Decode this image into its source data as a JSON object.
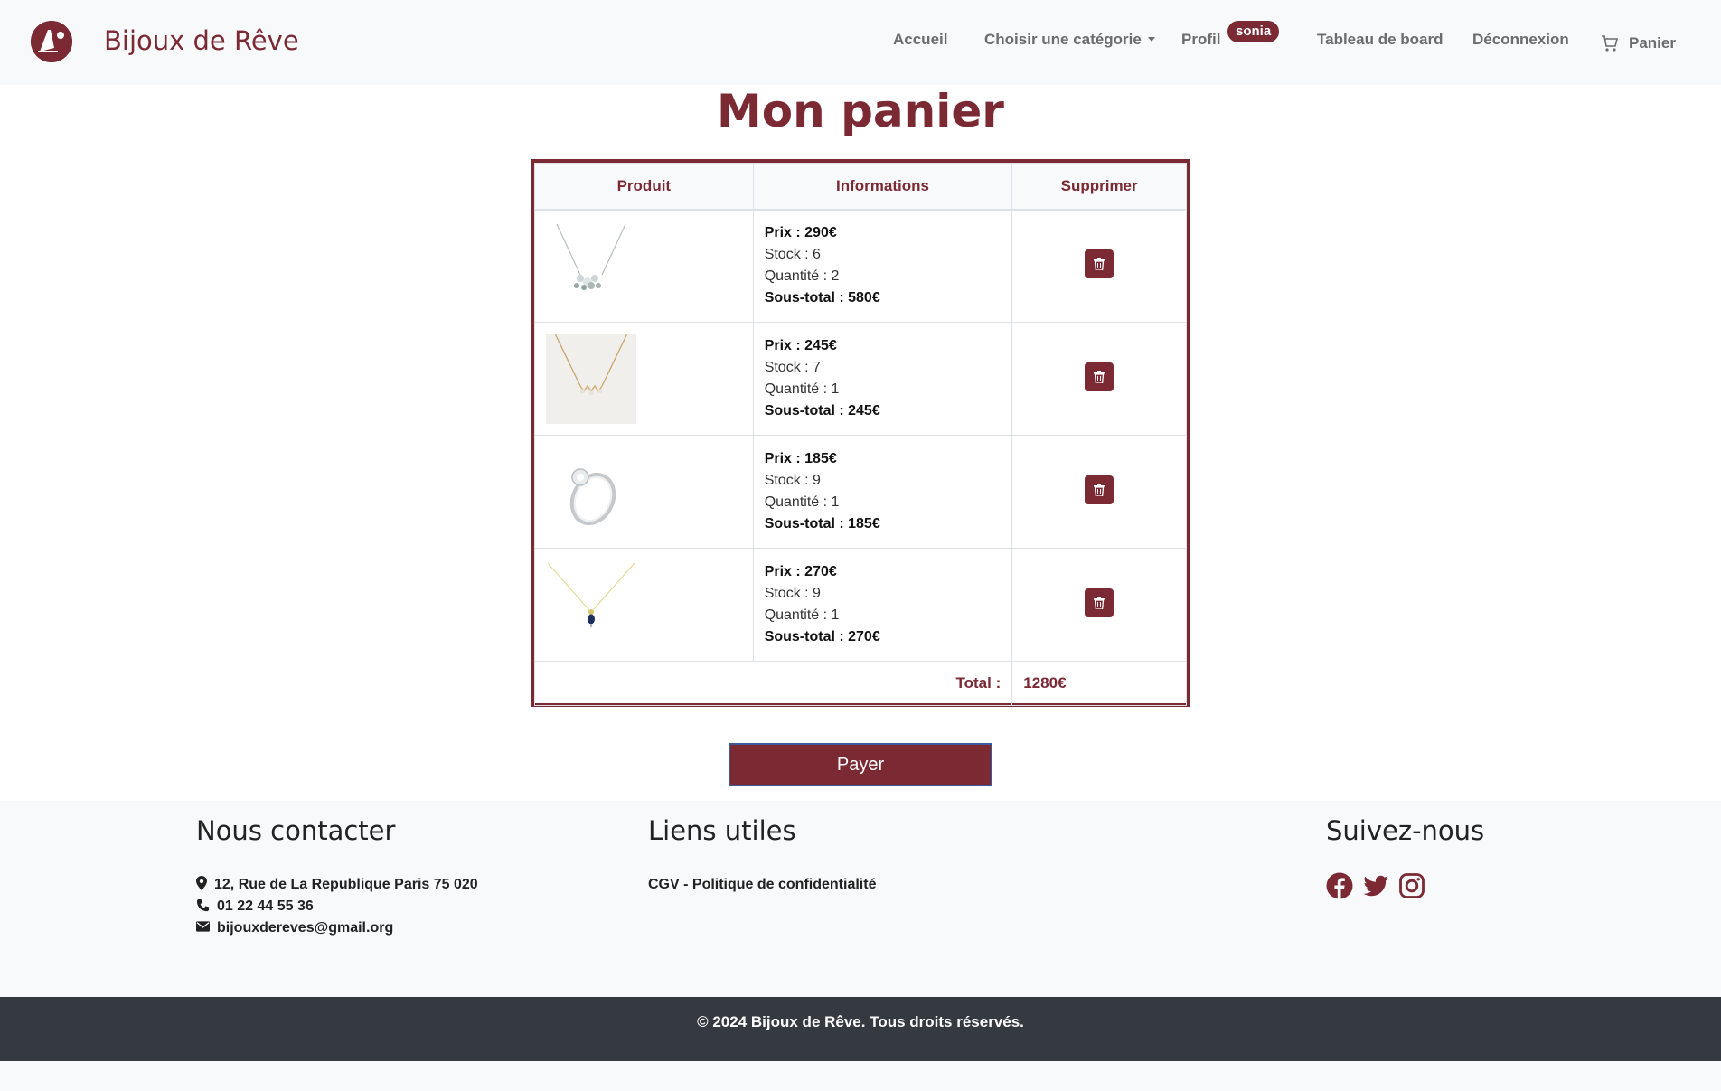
{
  "brand": {
    "name": "Bijoux de Rêve",
    "logo": "brand-logo"
  },
  "nav": {
    "home": "Accueil",
    "category": "Choisir une catégorie",
    "profile": "Profil",
    "user_badge": "sonia",
    "dashboard": "Tableau de board",
    "logout": "Déconnexion",
    "cart": "Panier"
  },
  "page": {
    "title": "Mon panier"
  },
  "table": {
    "headers": {
      "product": "Produit",
      "info": "Informations",
      "delete": "Supprimer"
    },
    "items": [
      {
        "image": "silver-necklace-icon",
        "price": "Prix : 290€",
        "stock": "Stock : 6",
        "quantity": "Quantité : 2",
        "subtotal": "Sous-total : 580€"
      },
      {
        "image": "gold-necklace-icon",
        "price": "Prix : 245€",
        "stock": "Stock : 7",
        "quantity": "Quantité : 1",
        "subtotal": "Sous-total : 245€"
      },
      {
        "image": "diamond-ring-icon",
        "price": "Prix : 185€",
        "stock": "Stock : 9",
        "quantity": "Quantité : 1",
        "subtotal": "Sous-total : 185€"
      },
      {
        "image": "sapphire-pendant-icon",
        "price": "Prix : 270€",
        "stock": "Stock : 9",
        "quantity": "Quantité : 1",
        "subtotal": "Sous-total : 270€"
      }
    ],
    "total_label": "Total :",
    "total_value": "1280€"
  },
  "pay_button": "Payer",
  "footer": {
    "contact_title": "Nous contacter",
    "address": "12, Rue de La Republique Paris 75 020",
    "phone": "01 22 44 55 36",
    "email": "bijouxdereves@gmail.org",
    "links_title": "Liens utiles",
    "link_cgv": "CGV - Politique de confidentialité",
    "social_title": "Suivez-nous",
    "social": [
      "facebook-icon",
      "twitter-icon",
      "instagram-icon"
    ],
    "copyright": "© 2024 Bijoux de Rêve. Tous droits réservés."
  },
  "colors": {
    "accent": "#7b2a34",
    "footer_dark": "#343a40",
    "light_bg": "#f8f9fa"
  }
}
